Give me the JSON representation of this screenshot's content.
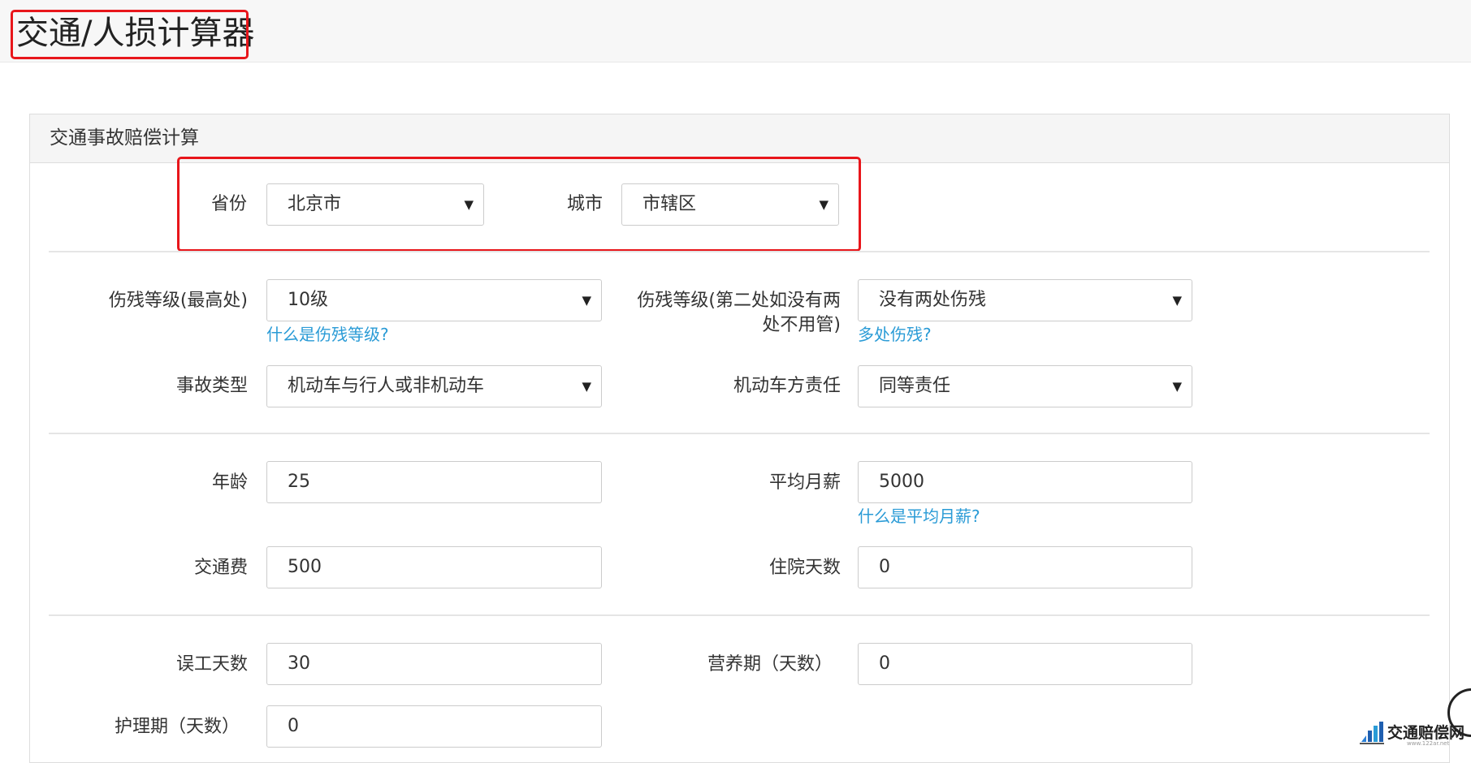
{
  "header": {
    "title": "交通/人损计算器"
  },
  "panel": {
    "title": "交通事故赔偿计算"
  },
  "location": {
    "province_label": "省份",
    "province_value": "北京市",
    "city_label": "城市",
    "city_value": "市辖区"
  },
  "disability": {
    "level_label": "伤残等级(最高处)",
    "level_value": "10级",
    "level_help": "什么是伤残等级?",
    "second_label_line1": "伤残等级(第二处如没有两",
    "second_label_line2": "处不用管)",
    "second_value": "没有两处伤残",
    "second_help": "多处伤残?"
  },
  "accident": {
    "type_label": "事故类型",
    "type_value": "机动车与行人或非机动车",
    "responsibility_label": "机动车方责任",
    "responsibility_value": "同等责任"
  },
  "personal": {
    "age_label": "年龄",
    "age_value": "25",
    "salary_label": "平均月薪",
    "salary_value": "5000",
    "salary_help": "什么是平均月薪?",
    "transport_label": "交通费",
    "transport_value": "500",
    "hospital_label": "住院天数",
    "hospital_value": "0"
  },
  "days": {
    "lost_work_label": "误工天数",
    "lost_work_value": "30",
    "nutrition_label": "营养期（天数）",
    "nutrition_value": "0",
    "nursing_label": "护理期（天数）",
    "nursing_value": "0"
  },
  "watermark": {
    "name": "交通赔偿网",
    "url": "www.122ar.net"
  },
  "icons": {
    "dropdown": "caret-down-icon",
    "logo": "bar-chart-logo-icon"
  },
  "colors": {
    "highlight": "#e8161b",
    "link": "#2a9bd6"
  }
}
